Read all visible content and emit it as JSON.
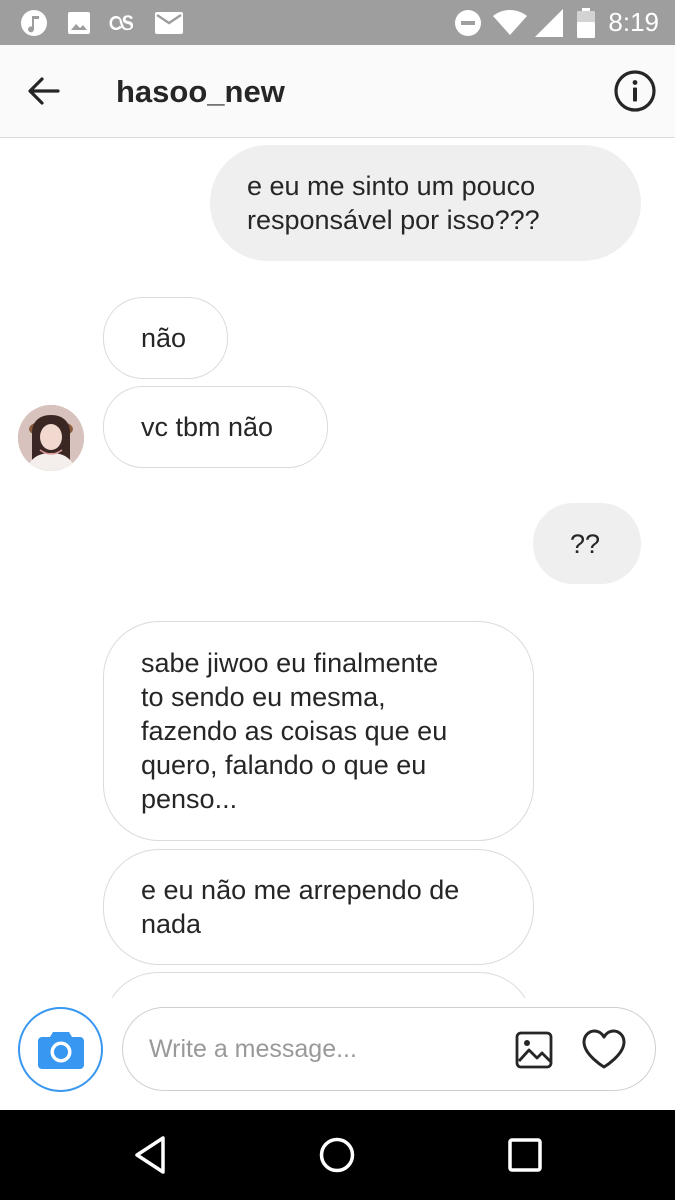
{
  "status_bar": {
    "time": "8:19",
    "left_icons": [
      "music-note-icon",
      "image-icon",
      "lastfm-icon",
      "mail-icon"
    ],
    "right_icons": [
      "do-not-disturb-icon",
      "wifi-icon",
      "cell-signal-icon",
      "battery-icon"
    ]
  },
  "header": {
    "title": "hasoo_new",
    "back_icon": "arrow-left-icon",
    "info_icon": "info-icon"
  },
  "messages": [
    {
      "direction": "outgoing",
      "text": "e eu me sinto um pouco\nresponsável por isso???"
    },
    {
      "direction": "incoming",
      "text": "não"
    },
    {
      "direction": "incoming",
      "text": "vc tbm não"
    },
    {
      "direction": "outgoing",
      "text": "??"
    },
    {
      "direction": "incoming",
      "text": "sabe jiwoo eu finalmente\nto sendo eu mesma,\nfazendo as coisas que eu\nquero, falando o que eu\npenso..."
    },
    {
      "direction": "incoming",
      "text": "e eu não me arrependo de\nnada"
    }
  ],
  "composer": {
    "placeholder": "Write a message...",
    "value": "",
    "camera_icon": "camera-icon",
    "gallery_icon": "gallery-icon",
    "like_icon": "heart-icon"
  },
  "colors": {
    "accent": "#3897f0",
    "outgoing_bubble": "#efefef",
    "incoming_border": "#dbdbdb",
    "status_bar": "#9e9e9e"
  },
  "nav_bar": [
    "back-triangle-icon",
    "home-circle-icon",
    "recents-square-icon"
  ]
}
